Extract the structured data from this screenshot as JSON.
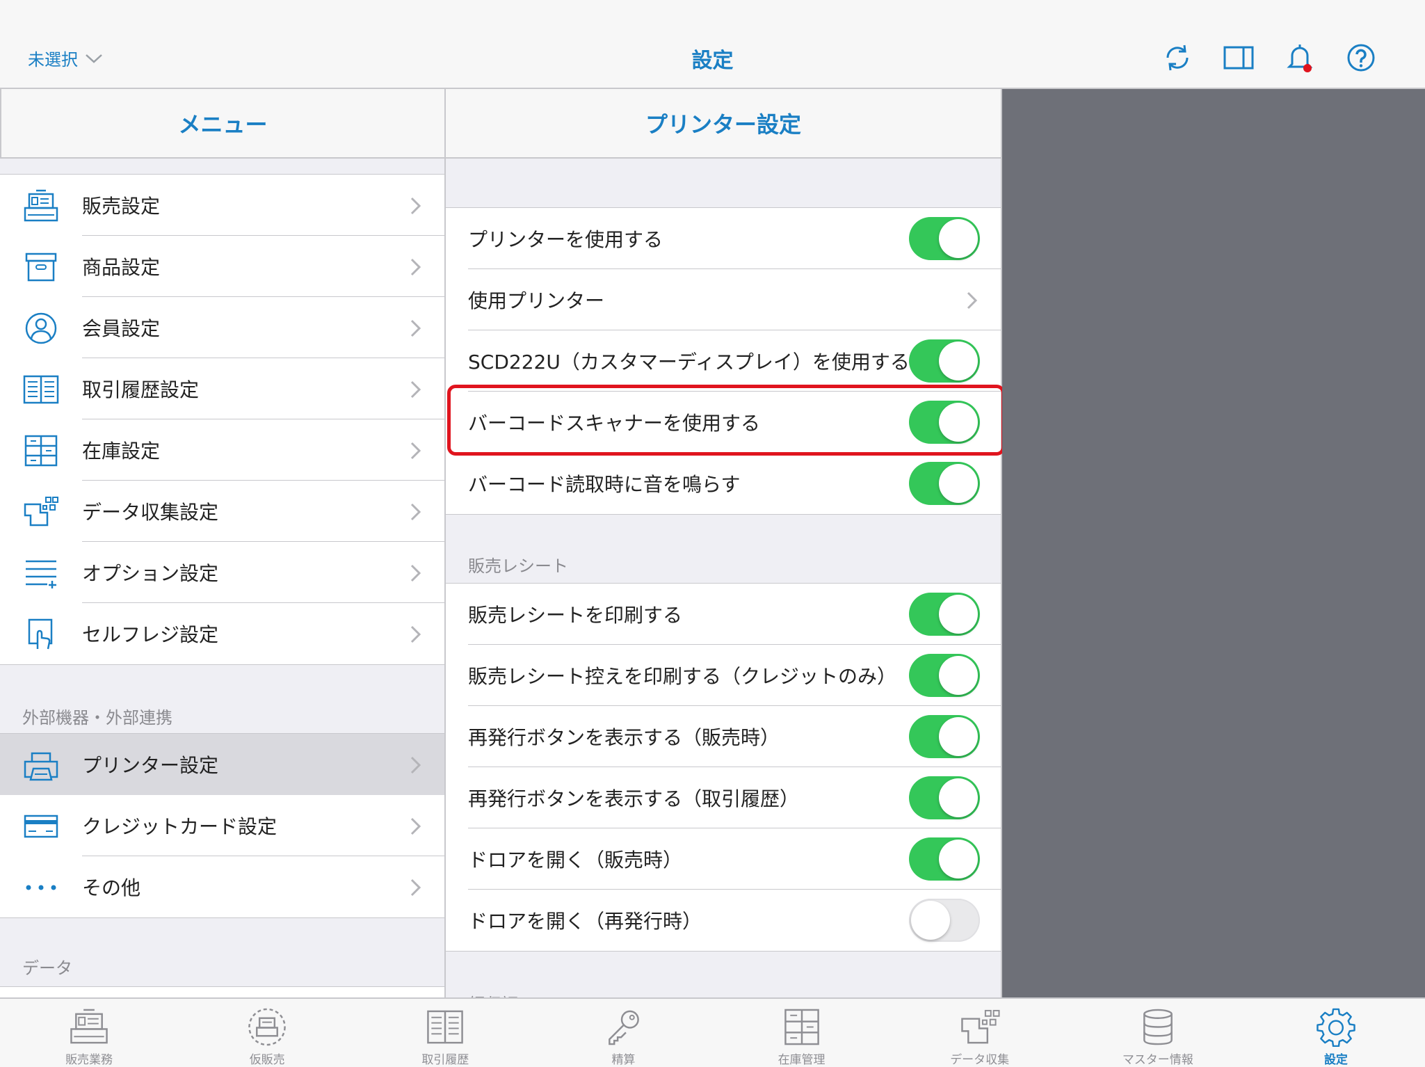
{
  "topbar": {
    "store_select": "未選択",
    "title": "設定"
  },
  "menu": {
    "header": "メニュー",
    "items": [
      {
        "label": "販売設定",
        "icon": "register-icon"
      },
      {
        "label": "商品設定",
        "icon": "box-icon"
      },
      {
        "label": "会員設定",
        "icon": "person-icon"
      },
      {
        "label": "取引履歴設定",
        "icon": "book-icon"
      },
      {
        "label": "在庫設定",
        "icon": "shelves-icon"
      },
      {
        "label": "データ収集設定",
        "icon": "data-collect-icon"
      },
      {
        "label": "オプション設定",
        "icon": "list-add-icon"
      },
      {
        "label": "セルフレジ設定",
        "icon": "self-register-icon"
      }
    ],
    "section_external": "外部機器・外部連携",
    "external_items": [
      {
        "label": "プリンター設定",
        "icon": "printer-icon",
        "selected": true
      },
      {
        "label": "クレジットカード設定",
        "icon": "credit-card-icon"
      },
      {
        "label": "その他",
        "icon": "more-icon"
      }
    ],
    "section_data": "データ"
  },
  "printer": {
    "header": "プリンター設定",
    "rows": [
      {
        "label": "プリンターを使用する",
        "toggle": true
      },
      {
        "label": "使用プリンター",
        "chevron": true
      },
      {
        "label": "SCD222U（カスタマーディスプレイ）を使用する",
        "toggle": true
      },
      {
        "label": "バーコードスキャナーを使用する",
        "toggle": true,
        "highlighted": true
      },
      {
        "label": "バーコード読取時に音を鳴らす",
        "toggle": true
      }
    ],
    "section_receipt": "販売レシート",
    "receipt_rows": [
      {
        "label": "販売レシートを印刷する",
        "toggle": true
      },
      {
        "label": "販売レシート控えを印刷する（クレジットのみ）",
        "toggle": true
      },
      {
        "label": "再発行ボタンを表示する（販売時）",
        "toggle": true
      },
      {
        "label": "再発行ボタンを表示する（取引履歴）",
        "toggle": true
      },
      {
        "label": "ドロアを開く（販売時）",
        "toggle": true
      },
      {
        "label": "ドロアを開く（再発行時）",
        "toggle": false
      }
    ],
    "section_invoice": "領収証"
  },
  "tabs": [
    {
      "label": "販売業務",
      "icon": "register-icon"
    },
    {
      "label": "仮販売",
      "icon": "temp-sale-icon"
    },
    {
      "label": "取引履歴",
      "icon": "book-icon"
    },
    {
      "label": "精算",
      "icon": "key-icon"
    },
    {
      "label": "在庫管理",
      "icon": "shelves-icon"
    },
    {
      "label": "データ収集",
      "icon": "data-collect-icon"
    },
    {
      "label": "マスター情報",
      "icon": "database-icon"
    },
    {
      "label": "設定",
      "icon": "gear-icon",
      "active": true
    }
  ],
  "colors": {
    "accent": "#1a7fc4",
    "toggle_on": "#34c759",
    "highlight": "#e0141e",
    "detail_pane": "#6e7078",
    "notification_dot": "#e0141e"
  }
}
